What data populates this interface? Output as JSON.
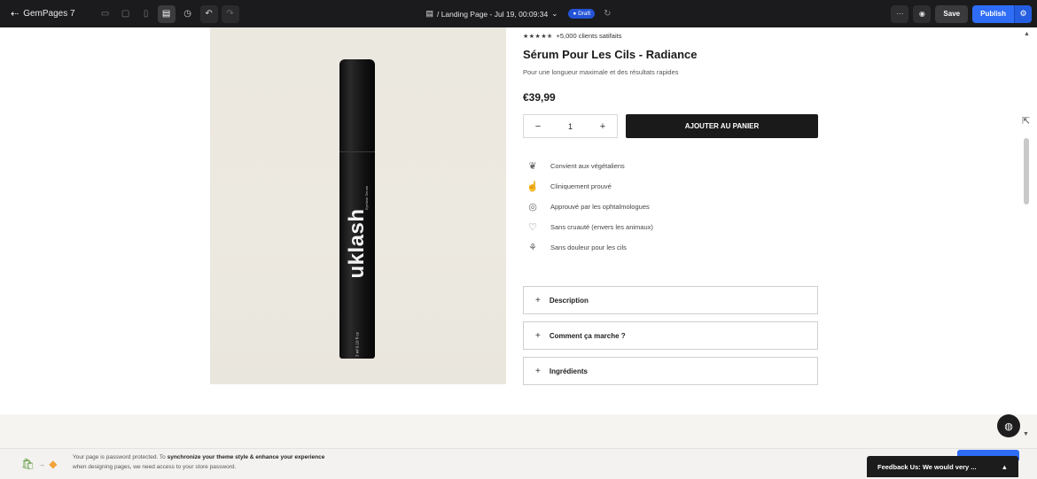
{
  "toolbar": {
    "app_name": "GemPages 7",
    "page_path": "/ Landing Page - Jul 19, 00:09:34",
    "status_badge": "Draft",
    "save_label": "Save",
    "publish_label": "Publish",
    "more_label": "···",
    "icons": [
      "back-arrow-icon",
      "desktop-icon",
      "tablet-icon",
      "mobile-icon",
      "layout-icon",
      "history-icon",
      "undo-icon",
      "redo-icon",
      "page-icon",
      "chevron-down-icon",
      "preview-icon",
      "gear-icon"
    ]
  },
  "product": {
    "image_brand": "uklash",
    "image_subtitle": "Eyelash Serum",
    "image_volume": "3 ml  0.10 fl oz",
    "stars": "★★★★✬",
    "rating_text": "+5,000 clients satifaits",
    "title": "Sérum Pour Les Cils - Radiance",
    "subtitle": "Pour une longueur maximale et des résultats rapides",
    "price": "€39,99",
    "quantity": "1",
    "qty_minus": "−",
    "qty_plus": "+",
    "add_to_cart": "AJOUTER AU PANIER",
    "features": [
      {
        "label": "Convient aux végétaliens",
        "icon": "leaf-icon"
      },
      {
        "label": "Cliniquement prouvé",
        "icon": "hand-icon"
      },
      {
        "label": "Approuvé par les ophtalmologues",
        "icon": "eye-icon"
      },
      {
        "label": "Sans cruauté (envers les animaux)",
        "icon": "heart-icon"
      },
      {
        "label": "Sans douleur pour les cils",
        "icon": "eyelash-icon"
      }
    ],
    "accordions": [
      {
        "label": "Description"
      },
      {
        "label": "Comment ça marche ?"
      },
      {
        "label": "Ingrédients"
      }
    ]
  },
  "notice": {
    "line1_prefix": "Your page is password protected. To ",
    "line1_bold": "synchronize your theme style & enhance your experience",
    "line2": "when designing pages, we need access to your store password."
  },
  "feedback": {
    "label": "Feedback Us: We would very ...",
    "chevron": "▲"
  },
  "colors": {
    "toolbar_bg": "#1b1b1d",
    "publish_blue": "#2f6df6",
    "cart_button": "#1a1a1a",
    "image_bg": "#ece9e1"
  }
}
